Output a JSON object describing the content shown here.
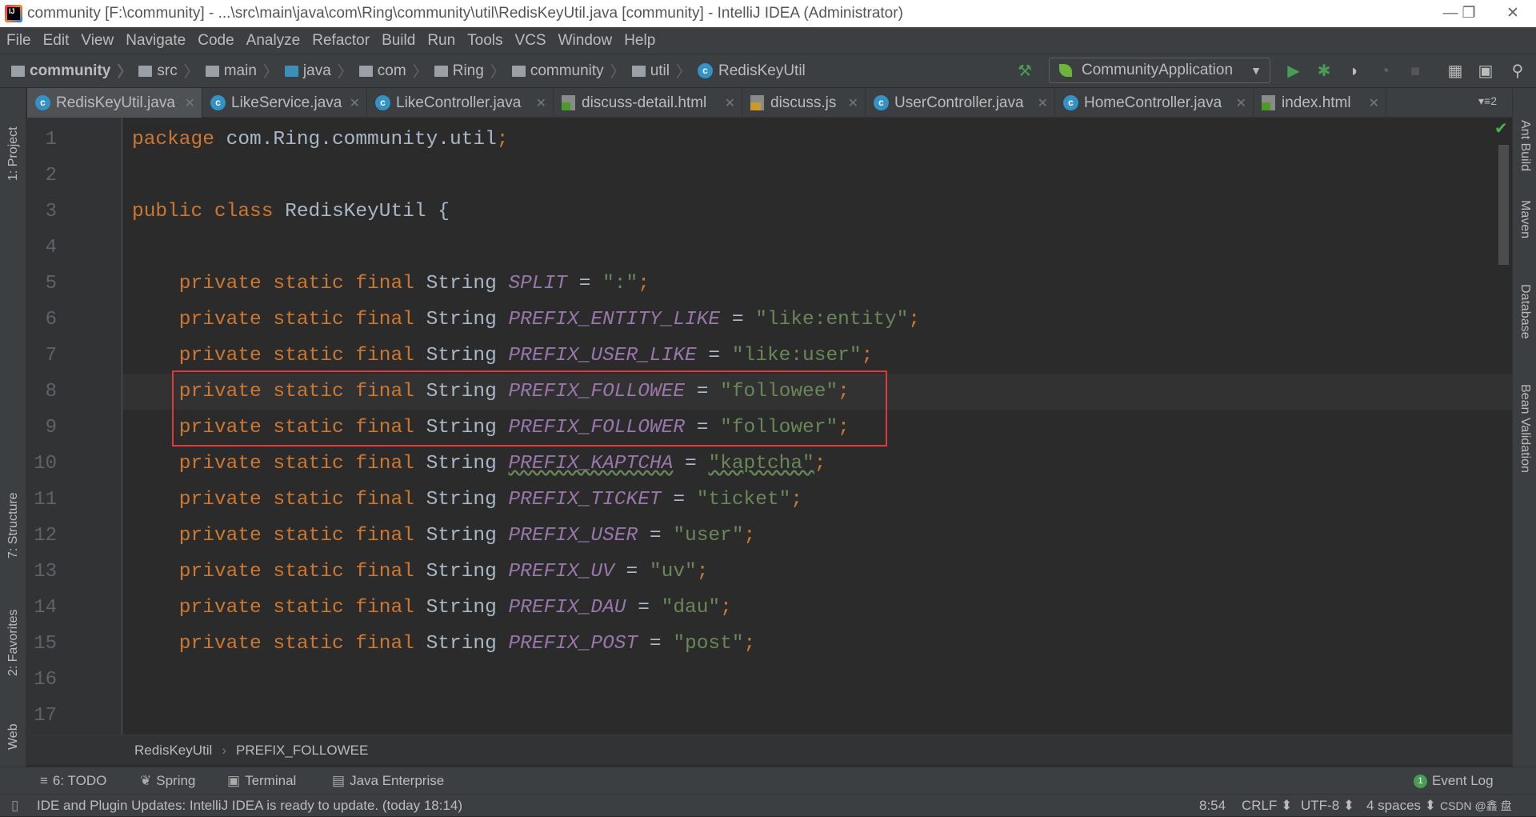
{
  "window": {
    "title": "community [F:\\community] - ...\\src\\main\\java\\com\\Ring\\community\\util\\RedisKeyUtil.java [community] - IntelliJ IDEA (Administrator)",
    "app_icon": "intellij-logo",
    "minimize": "—",
    "restore": "❐",
    "close": "✕"
  },
  "menu": [
    "File",
    "Edit",
    "View",
    "Navigate",
    "Code",
    "Analyze",
    "Refactor",
    "Build",
    "Run",
    "Tools",
    "VCS",
    "Window",
    "Help"
  ],
  "breadcrumbs": [
    "community",
    "src",
    "main",
    "java",
    "com",
    "Ring",
    "community",
    "util",
    "RedisKeyUtil"
  ],
  "toolbar": {
    "run_config": "CommunityApplication",
    "icons": [
      "build-hammer-icon",
      "run-icon",
      "debug-icon",
      "coverage-icon",
      "profile-icon",
      "stop-icon",
      "project-structure-icon",
      "terminal-icon",
      "search-icon"
    ]
  },
  "tabs": [
    {
      "label": "RedisKeyUtil.java",
      "type": "java",
      "active": true
    },
    {
      "label": "LikeService.java",
      "type": "java"
    },
    {
      "label": "LikeController.java",
      "type": "java"
    },
    {
      "label": "discuss-detail.html",
      "type": "html"
    },
    {
      "label": "discuss.js",
      "type": "js"
    },
    {
      "label": "UserController.java",
      "type": "java"
    },
    {
      "label": "HomeController.java",
      "type": "java"
    },
    {
      "label": "index.html",
      "type": "html"
    }
  ],
  "tab_overflow": "▾≡2",
  "left_tools": [
    "1: Project",
    "7: Structure",
    "2: Favorites",
    "Web"
  ],
  "right_tools": [
    "Ant Build",
    "Maven",
    "Database",
    "Bean Validation"
  ],
  "editor": {
    "current_line": 8,
    "highlighted_lines": [
      8,
      9
    ],
    "highlight_color": "#e0383e",
    "lines": [
      [
        {
          "t": "package ",
          "k": "kw"
        },
        {
          "t": "com.Ring.community.util",
          "k": "plain"
        },
        {
          "t": ";",
          "k": "kw"
        }
      ],
      [],
      [
        {
          "t": "public class ",
          "k": "kw"
        },
        {
          "t": "RedisKeyUtil {",
          "k": "plain"
        }
      ],
      [],
      [
        {
          "t": "    private static final ",
          "k": "kw"
        },
        {
          "t": "String ",
          "k": "cls"
        },
        {
          "t": "SPLIT",
          "k": "const"
        },
        {
          "t": " = ",
          "k": "plain"
        },
        {
          "t": "\":\"",
          "k": "str"
        },
        {
          "t": ";",
          "k": "kw"
        }
      ],
      [
        {
          "t": "    private static final ",
          "k": "kw"
        },
        {
          "t": "String ",
          "k": "cls"
        },
        {
          "t": "PREFIX_ENTITY_LIKE",
          "k": "const"
        },
        {
          "t": " = ",
          "k": "plain"
        },
        {
          "t": "\"like:entity\"",
          "k": "str"
        },
        {
          "t": ";",
          "k": "kw"
        }
      ],
      [
        {
          "t": "    private static final ",
          "k": "kw"
        },
        {
          "t": "String ",
          "k": "cls"
        },
        {
          "t": "PREFIX_USER_LIKE",
          "k": "const"
        },
        {
          "t": " = ",
          "k": "plain"
        },
        {
          "t": "\"like:user\"",
          "k": "str"
        },
        {
          "t": ";",
          "k": "kw"
        }
      ],
      [
        {
          "t": "    private static final ",
          "k": "kw"
        },
        {
          "t": "String ",
          "k": "cls"
        },
        {
          "t": "PREFIX_FOLLOWEE",
          "k": "const"
        },
        {
          "t": " = ",
          "k": "plain"
        },
        {
          "t": "\"followee\"",
          "k": "str"
        },
        {
          "t": ";",
          "k": "kw"
        }
      ],
      [
        {
          "t": "    private static final ",
          "k": "kw"
        },
        {
          "t": "String ",
          "k": "cls"
        },
        {
          "t": "PREFIX_FOLLOWER",
          "k": "const"
        },
        {
          "t": " = ",
          "k": "plain"
        },
        {
          "t": "\"follower\"",
          "k": "str"
        },
        {
          "t": ";",
          "k": "kw"
        }
      ],
      [
        {
          "t": "    private static final ",
          "k": "kw"
        },
        {
          "t": "String ",
          "k": "cls"
        },
        {
          "t": "PREFIX_KAPTCHA",
          "k": "const warn"
        },
        {
          "t": " = ",
          "k": "plain"
        },
        {
          "t": "\"kaptcha\"",
          "k": "str warn"
        },
        {
          "t": ";",
          "k": "kw"
        }
      ],
      [
        {
          "t": "    private static final ",
          "k": "kw"
        },
        {
          "t": "String ",
          "k": "cls"
        },
        {
          "t": "PREFIX_TICKET",
          "k": "const"
        },
        {
          "t": " = ",
          "k": "plain"
        },
        {
          "t": "\"ticket\"",
          "k": "str"
        },
        {
          "t": ";",
          "k": "kw"
        }
      ],
      [
        {
          "t": "    private static final ",
          "k": "kw"
        },
        {
          "t": "String ",
          "k": "cls"
        },
        {
          "t": "PREFIX_USER",
          "k": "const"
        },
        {
          "t": " = ",
          "k": "plain"
        },
        {
          "t": "\"user\"",
          "k": "str"
        },
        {
          "t": ";",
          "k": "kw"
        }
      ],
      [
        {
          "t": "    private static final ",
          "k": "kw"
        },
        {
          "t": "String ",
          "k": "cls"
        },
        {
          "t": "PREFIX_UV",
          "k": "const"
        },
        {
          "t": " = ",
          "k": "plain"
        },
        {
          "t": "\"uv\"",
          "k": "str"
        },
        {
          "t": ";",
          "k": "kw"
        }
      ],
      [
        {
          "t": "    private static final ",
          "k": "kw"
        },
        {
          "t": "String ",
          "k": "cls"
        },
        {
          "t": "PREFIX_DAU",
          "k": "const"
        },
        {
          "t": " = ",
          "k": "plain"
        },
        {
          "t": "\"dau\"",
          "k": "str"
        },
        {
          "t": ";",
          "k": "kw"
        }
      ],
      [
        {
          "t": "    private static final ",
          "k": "kw"
        },
        {
          "t": "String ",
          "k": "cls"
        },
        {
          "t": "PREFIX_POST",
          "k": "const"
        },
        {
          "t": " = ",
          "k": "plain"
        },
        {
          "t": "\"post\"",
          "k": "str"
        },
        {
          "t": ";",
          "k": "kw"
        }
      ],
      [],
      []
    ]
  },
  "code_breadcrumb": {
    "class": "RedisKeyUtil",
    "sep": "›",
    "member": "PREFIX_FOLLOWEE"
  },
  "tool_windows": {
    "todo": "6: TODO",
    "spring": "Spring",
    "terminal": "Terminal",
    "java_enterprise": "Java Enterprise",
    "event_log": "Event Log",
    "event_count": "1"
  },
  "status": {
    "message": "IDE and Plugin Updates: IntelliJ IDEA is ready to update. (today 18:14)",
    "position": "8:54",
    "line_sep": "CRLF ⬍",
    "encoding": "UTF-8 ⬍",
    "indent": "4 spaces ⬍",
    "watermark": "CSDN @鑫 盘"
  }
}
